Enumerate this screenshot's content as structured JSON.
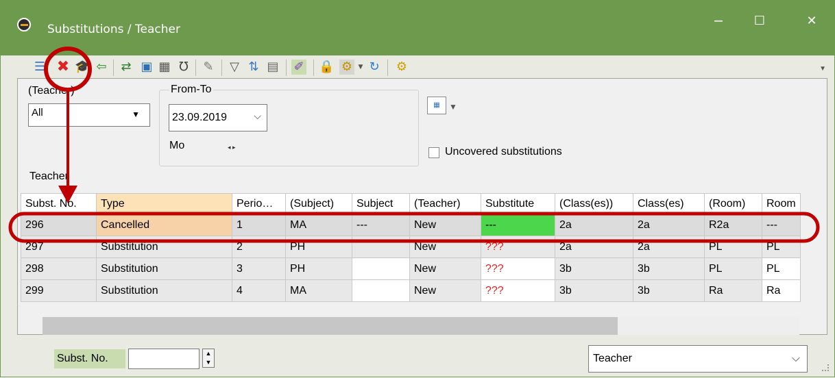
{
  "window": {
    "title": "Substitutions / Teacher",
    "minimize": "‒",
    "maximize": "☐",
    "close": "✕"
  },
  "toolbar": {
    "icons": [
      "list-icon",
      "delete-icon",
      "teacher-icon",
      "export-icon",
      "import-icon",
      "document-icon",
      "calculator-icon",
      "stethoscope-icon",
      "magic-icon",
      "filter-icon",
      "sort-icon",
      "columns-icon",
      "edit-icon",
      "lock-icon",
      "settings-dropdown-icon",
      "refresh-icon",
      "gear-icon"
    ]
  },
  "filters": {
    "teacher_label": "(Teacher)",
    "teacher_value": "All",
    "fromto_label": "From-To",
    "date_value": "23.09.2019",
    "day_label": "Mo",
    "uncovered_label": "Uncovered substitutions",
    "group_label": "Teacher"
  },
  "grid": {
    "headers": [
      "Subst. No.",
      "Type",
      "Perio…",
      "(Subject)",
      "Subject",
      "(Teacher)",
      "Substitute",
      "(Class(es))",
      "Class(es)",
      "(Room)",
      "Room"
    ],
    "rows": [
      [
        "296",
        "Cancelled",
        "1",
        "MA",
        "---",
        "New",
        "---",
        "2a",
        "2a",
        "R2a",
        "---"
      ],
      [
        "297",
        "Substitution",
        "2",
        "PH",
        "",
        "New",
        "???",
        "2a",
        "2a",
        "PL",
        "PL"
      ],
      [
        "298",
        "Substitution",
        "3",
        "PH",
        "",
        "New",
        "???",
        "3b",
        "3b",
        "PL",
        "PL"
      ],
      [
        "299",
        "Substitution",
        "4",
        "MA",
        "",
        "New",
        "???",
        "3b",
        "3b",
        "Ra",
        "Ra"
      ]
    ]
  },
  "bottom": {
    "subst_no_label": "Subst. No.",
    "subst_no_value": "",
    "view_value": "Teacher"
  },
  "colors": {
    "titlebar": "#6e9a4e",
    "annotation": "#c00000",
    "substitute_highlight": "#4bd64b",
    "missing": "#e02020"
  }
}
